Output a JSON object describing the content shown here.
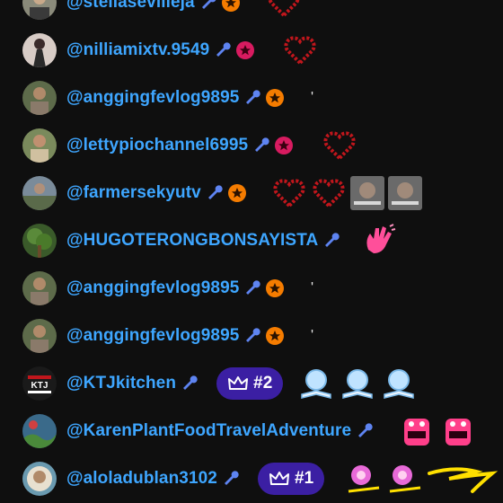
{
  "messages": [
    {
      "author": "@stellasevilleja",
      "badge_color": "#f57c00",
      "avatar_color": "#8a8a7a",
      "emoji": [
        "heart-wreath"
      ]
    },
    {
      "author": "@nilliamixtv.9549",
      "badge_color": "#d81b60",
      "avatar_color": "#c8b8b0",
      "emoji": [
        "heart-wreath"
      ]
    },
    {
      "author": "@anggingfevlog9895",
      "badge_color": "#f57c00",
      "avatar_color": "#5d6b4a",
      "text": "'"
    },
    {
      "author": "@lettypiochannel6995",
      "badge_color": "#d81b60",
      "avatar_color": "#7a8a5c",
      "emoji": [
        "heart-wreath"
      ]
    },
    {
      "author": "@farmersekyutv",
      "badge_color": "#f57c00",
      "avatar_color": "#7a8b9a",
      "emoji": [
        "heart-wreath",
        "heart-wreath",
        "photo-sticker",
        "photo-sticker"
      ]
    },
    {
      "author": "@HUGOTERONGBONSAYISTA",
      "avatar_color": "#4a6a3a",
      "emoji": [
        "waving-hand"
      ]
    },
    {
      "author": "@anggingfevlog9895",
      "badge_color": "#f57c00",
      "avatar_color": "#5d6b4a",
      "text": "'"
    },
    {
      "author": "@anggingfevlog9895",
      "badge_color": "#f57c00",
      "avatar_color": "#5d6b4a",
      "text": "'"
    },
    {
      "author": "@KTJkitchen",
      "avatar_color": "#1a1a1a",
      "avatar_text": "KTJ",
      "rank": "#2",
      "emoji": [
        "lightbulb-book",
        "lightbulb-book",
        "lightbulb-book"
      ]
    },
    {
      "author": "@KarenPlantFoodTravelAdventure",
      "avatar_color": "#3a6a8a",
      "emoji": [
        "pink-monster",
        "pink-monster"
      ]
    },
    {
      "author": "@aloladublan3102",
      "avatar_color": "#6a9ab0",
      "rank": "#1",
      "emoji": [
        "flower-sticker",
        "flower-sticker",
        "scribble"
      ]
    }
  ],
  "colors": {
    "author": "#3ea6ff",
    "rank_bg": "#3b1fa3",
    "background": "#0f0f0f"
  }
}
